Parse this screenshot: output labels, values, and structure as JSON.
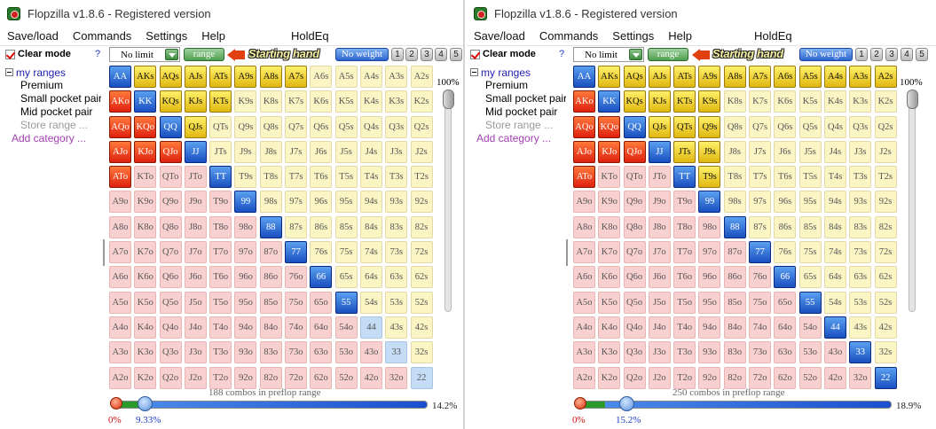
{
  "panels": [
    {
      "title": "Flopzilla v1.8.6 - Registered version",
      "menu": [
        "Save/load",
        "Commands",
        "Settings",
        "Help"
      ],
      "holdeq": "HoldEq",
      "clear_mode": "Clear mode",
      "help_mark": "?",
      "game_select": "No limit",
      "range_button": "range",
      "starting_hand": "Starting hand",
      "weight_button": "No weight",
      "number_buttons": [
        "1",
        "2",
        "3",
        "4",
        "5"
      ],
      "tree": {
        "root": "my ranges",
        "items": [
          "Premium",
          "Small pocket pair",
          "Mid pocket pair"
        ],
        "store": "Store range ...",
        "add": "Add category ..."
      },
      "vertical_percent": "100%",
      "combos_text": "188 combos in preflop range",
      "horizontal_right": "14.2%",
      "horizontal_low": "0%",
      "horizontal_high": "9.33%",
      "range_fraction": 0.0933,
      "selected_hands": [
        "AA",
        "KK",
        "QQ",
        "JJ",
        "TT",
        "99",
        "88",
        "77",
        "66",
        "55",
        "AKs",
        "AQs",
        "AJs",
        "ATs",
        "A9s",
        "A8s",
        "A7s",
        "KQs",
        "KJs",
        "KTs",
        "QJs",
        "AKo",
        "AQo",
        "AJo",
        "ATo",
        "KQo",
        "KJo",
        "QJo"
      ]
    },
    {
      "title": "Flopzilla v1.8.6 - Registered version",
      "menu": [
        "Save/load",
        "Commands",
        "Settings",
        "Help"
      ],
      "holdeq": "HoldEq",
      "clear_mode": "Clear mode",
      "help_mark": "?",
      "game_select": "No limit",
      "range_button": "range",
      "starting_hand": "Starting hand",
      "weight_button": "No weight",
      "number_buttons": [
        "1",
        "2",
        "3",
        "4",
        "5"
      ],
      "tree": {
        "root": "my ranges",
        "items": [
          "Premium",
          "Small pocket pair",
          "Mid pocket pair"
        ],
        "store": "Store range ...",
        "add": "Add category ..."
      },
      "vertical_percent": "100%",
      "combos_text": "250 combos in preflop range",
      "horizontal_right": "18.9%",
      "horizontal_low": "0%",
      "horizontal_high": "15.2%",
      "range_fraction": 0.152,
      "selected_hands": [
        "AA",
        "KK",
        "QQ",
        "JJ",
        "TT",
        "99",
        "88",
        "77",
        "66",
        "55",
        "44",
        "33",
        "22",
        "AKs",
        "AQs",
        "AJs",
        "ATs",
        "A9s",
        "A8s",
        "A7s",
        "A6s",
        "A5s",
        "A4s",
        "A3s",
        "A2s",
        "KQs",
        "KJs",
        "KTs",
        "K9s",
        "QJs",
        "QTs",
        "Q9s",
        "JTs",
        "J9s",
        "T9s",
        "AKo",
        "AQo",
        "AJo",
        "ATo",
        "KQo",
        "KJo",
        "QJo"
      ]
    }
  ],
  "ranks": [
    "A",
    "K",
    "Q",
    "J",
    "T",
    "9",
    "8",
    "7",
    "6",
    "5",
    "4",
    "3",
    "2"
  ]
}
